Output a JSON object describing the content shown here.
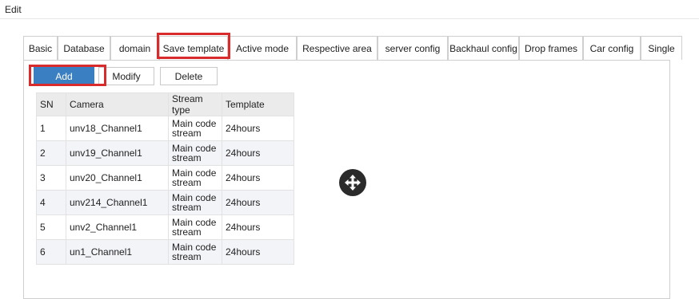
{
  "header": {
    "title": "Edit"
  },
  "tabs": [
    {
      "label": "Basic"
    },
    {
      "label": "Database"
    },
    {
      "label": "domain"
    },
    {
      "label": "Save template",
      "active": true
    },
    {
      "label": "Active mode"
    },
    {
      "label": "Respective area"
    },
    {
      "label": "server config"
    },
    {
      "label": "Backhaul config"
    },
    {
      "label": "Drop frames"
    },
    {
      "label": "Car config"
    },
    {
      "label": "Single"
    }
  ],
  "toolbar": {
    "add_label": "Add",
    "modify_label": "Modify",
    "delete_label": "Delete"
  },
  "table": {
    "columns": [
      "SN",
      "Camera",
      "Stream type",
      "Template"
    ],
    "rows": [
      {
        "sn": "1",
        "camera": "unv18_Channel1",
        "stream": "Main code stream",
        "template": "24hours"
      },
      {
        "sn": "2",
        "camera": "unv19_Channel1",
        "stream": "Main code stream",
        "template": "24hours"
      },
      {
        "sn": "3",
        "camera": "unv20_Channel1",
        "stream": "Main code stream",
        "template": "24hours"
      },
      {
        "sn": "4",
        "camera": "unv214_Channel1",
        "stream": "Main code stream",
        "template": "24hours"
      },
      {
        "sn": "5",
        "camera": "unv2_Channel1",
        "stream": "Main code stream",
        "template": "24hours"
      },
      {
        "sn": "6",
        "camera": "un1_Channel1",
        "stream": "Main code stream",
        "template": "24hours"
      }
    ]
  },
  "colors": {
    "primary": "#3a7fc2",
    "highlight": "#d92b2b",
    "row_alt": "#f2f4f8",
    "header_bg": "#ebebeb"
  },
  "icons": {
    "move_handle": "move-arrows-icon"
  }
}
